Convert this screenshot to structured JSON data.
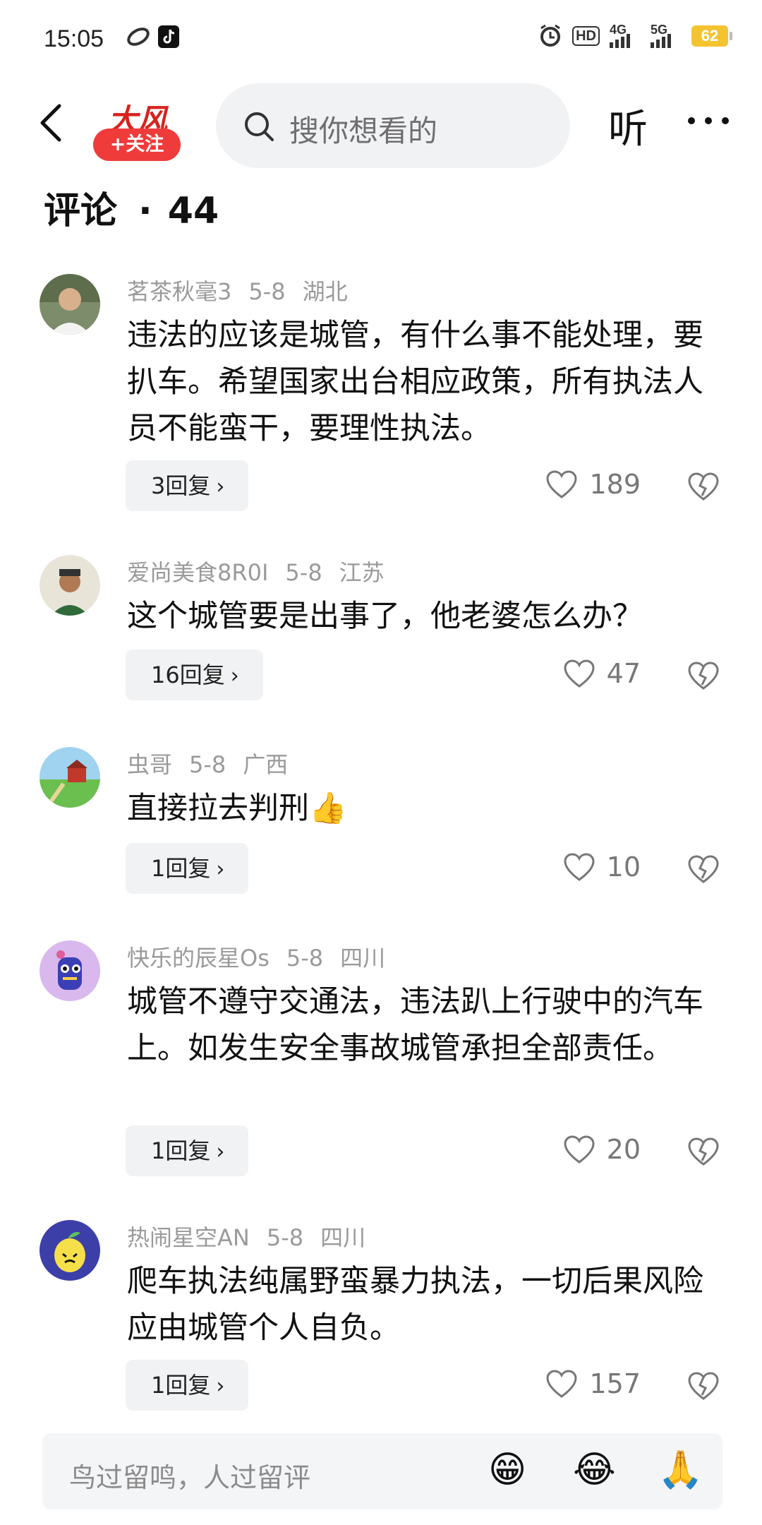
{
  "status_bar": {
    "time": "15:05",
    "hd": "HD",
    "network_1": "4G",
    "network_2": "5G",
    "battery": "62"
  },
  "nav": {
    "logo_text": "大风",
    "follow_label": "+关注",
    "search_placeholder": "搜你想看的",
    "listen_label": "听"
  },
  "comments_header": {
    "title": "评论",
    "dot": "·",
    "count": "44"
  },
  "comments": [
    {
      "user": "茗茶秋毫3",
      "date": "5-8",
      "location": "湖北",
      "text": "违法的应该是城管，有什么事不能处理，要扒车。希望国家出台相应政策，所有执法人员不能蛮干，要理性执法。",
      "replies": "3回复",
      "likes": "189"
    },
    {
      "user": "爱尚美食8R0I",
      "date": "5-8",
      "location": "江苏",
      "text": "这个城管要是出事了，他老婆怎么办？",
      "replies": "16回复",
      "likes": "47"
    },
    {
      "user": "虫哥",
      "date": "5-8",
      "location": "广西",
      "text": "直接拉去判刑👍",
      "replies": "1回复",
      "likes": "10"
    },
    {
      "user": "快乐的辰星Os",
      "date": "5-8",
      "location": "四川",
      "text": "城管不遵守交通法，违法趴上行驶中的汽车上。如发生安全事故城管承担全部责任。",
      "replies": "1回复",
      "likes": "20"
    },
    {
      "user": "热闹星空AN",
      "date": "5-8",
      "location": "四川",
      "text": "爬车执法纯属野蛮暴力执法，一切后果风险应由城管个人自负。",
      "replies": "1回复",
      "likes": "157"
    }
  ],
  "input": {
    "placeholder": "鸟过留鸣，人过留评",
    "emoji_1": "😁",
    "emoji_2": "😂",
    "emoji_3": "🙏"
  },
  "colors": {
    "follow_button": "#f03b3b",
    "battery": "#f4c430",
    "search_bg": "#f1f2f4"
  }
}
